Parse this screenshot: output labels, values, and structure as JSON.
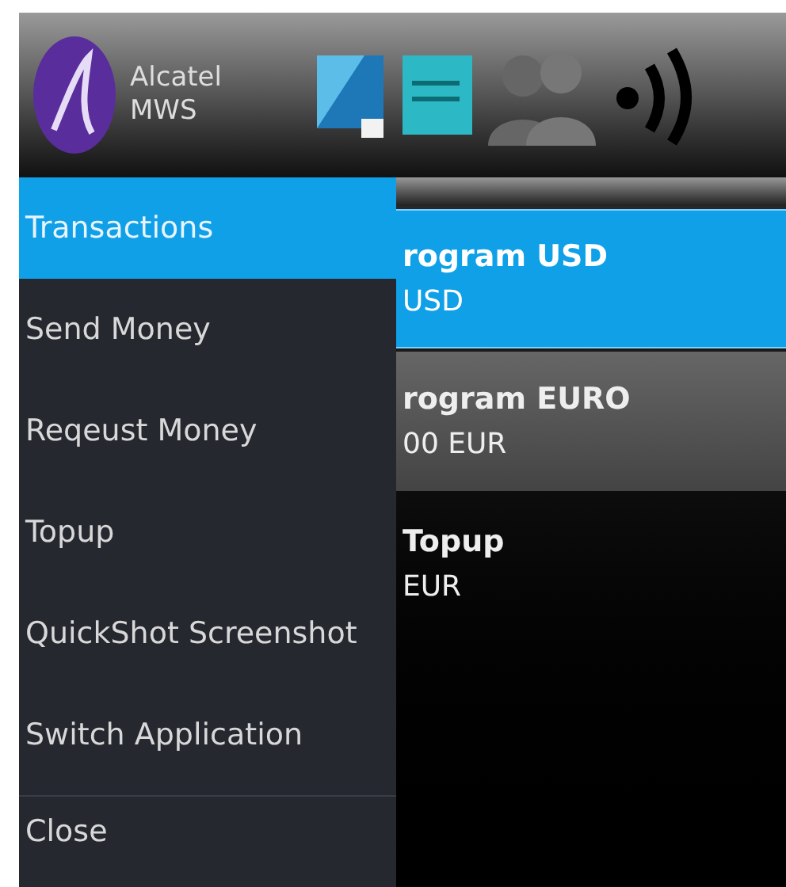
{
  "header": {
    "brand_lines": [
      "Alcatel",
      "MWS"
    ]
  },
  "menu": {
    "items": [
      {
        "label": "Transactions",
        "selected": true
      },
      {
        "label": "Send Money",
        "selected": false
      },
      {
        "label": "Reqeust Money",
        "selected": false
      },
      {
        "label": "Topup",
        "selected": false
      },
      {
        "label": "QuickShot Screenshot",
        "selected": false
      },
      {
        "label": "Switch Application",
        "selected": false
      }
    ],
    "footer_item": {
      "label": "Close"
    }
  },
  "list": {
    "rows": [
      {
        "title": "rogram USD",
        "subtitle": "USD",
        "selected": true
      },
      {
        "title": "rogram EURO",
        "subtitle": "00 EUR",
        "selected": false,
        "kind": "shaded"
      },
      {
        "title": "Topup",
        "subtitle": "EUR",
        "selected": false,
        "kind": "plain"
      }
    ]
  }
}
